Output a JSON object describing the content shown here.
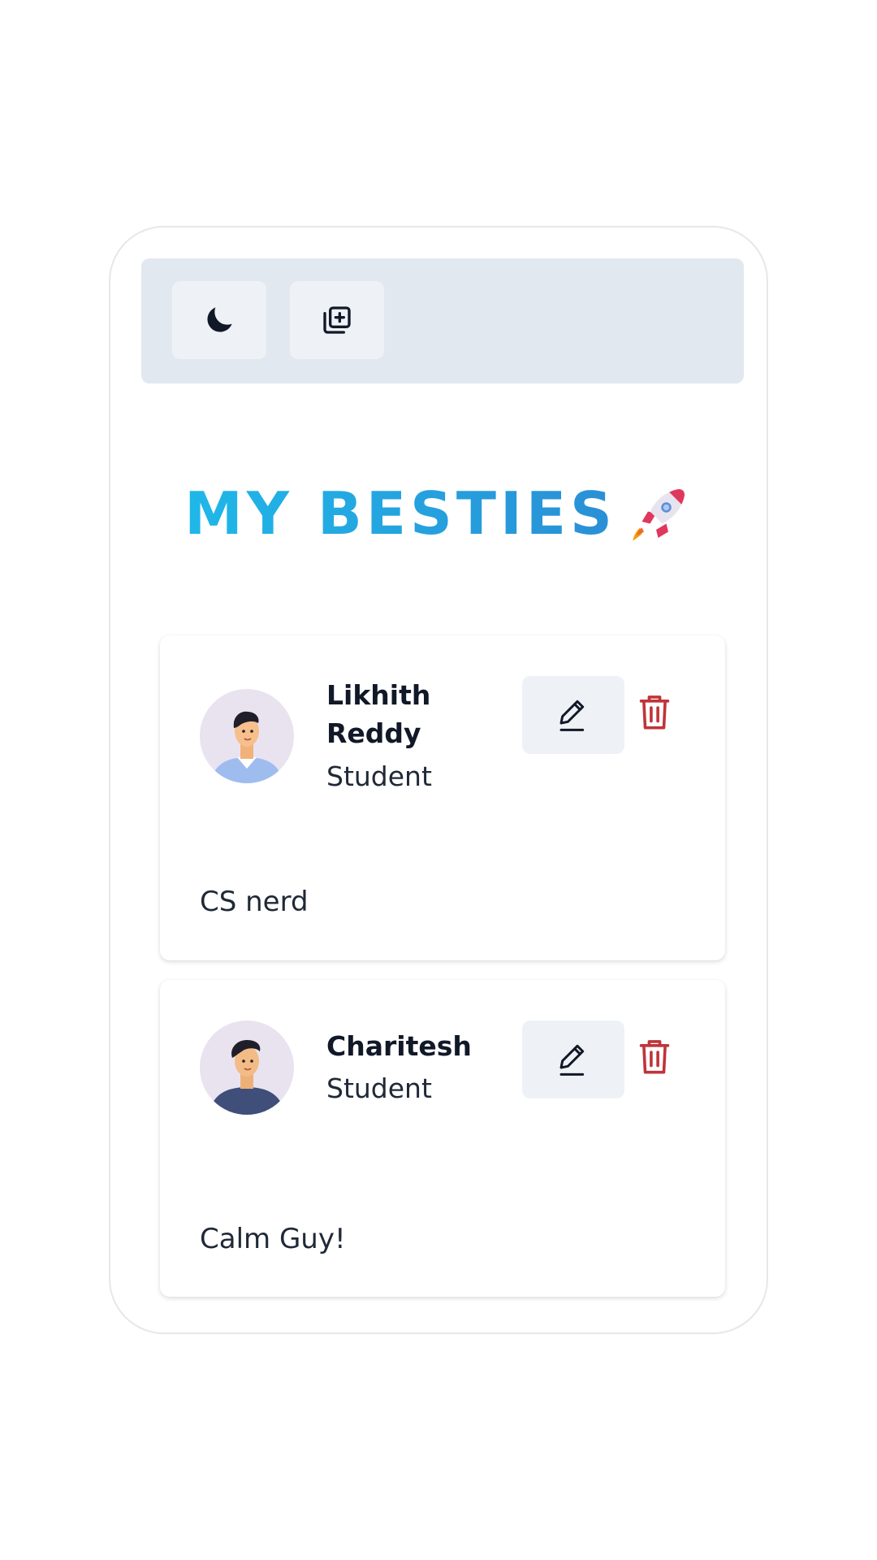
{
  "toolbar": {
    "theme_icon": "moon-icon",
    "add_icon": "add-friend-icon"
  },
  "title": {
    "text": "MY BESTIES",
    "emoji": "rocket-icon",
    "gradient_colors": [
      "#1fb8e8",
      "#2a8fd6"
    ]
  },
  "friends": [
    {
      "name": "Likhith Reddy",
      "role": "Student",
      "description": "CS nerd",
      "avatar_icon": "avatar-male-light-shirt-icon"
    },
    {
      "name": "Charitesh",
      "role": "Student",
      "description": "Calm Guy!",
      "avatar_icon": "avatar-male-dark-shirt-icon"
    }
  ],
  "actions": {
    "edit_icon": "pencil-icon",
    "delete_icon": "trash-icon",
    "delete_color": "#c0343a"
  }
}
